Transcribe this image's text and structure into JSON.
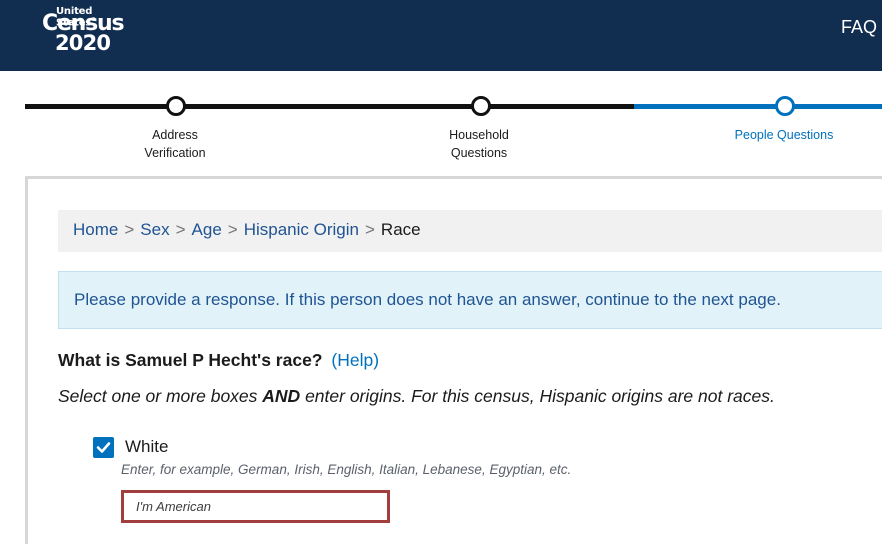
{
  "header": {
    "logo": {
      "line1": "United States",
      "line2": "Census",
      "line3": "2020"
    },
    "faq_label": "FAQ"
  },
  "progress": {
    "steps": [
      {
        "line1": "Address",
        "line2": "Verification",
        "state": "complete"
      },
      {
        "line1": "Household",
        "line2": "Questions",
        "state": "complete"
      },
      {
        "line1": "People Questions",
        "line2": "",
        "state": "current"
      }
    ]
  },
  "breadcrumb": {
    "items": [
      "Home",
      "Sex",
      "Age",
      "Hispanic Origin"
    ],
    "separator": ">",
    "current": "Race"
  },
  "alert": {
    "message": "Please provide a response. If this person does not have an answer, continue to the next page."
  },
  "question": {
    "text": "What is Samuel P Hecht's race?",
    "help_label": "(Help)",
    "instruction_before": "Select one or more boxes ",
    "instruction_bold": "AND",
    "instruction_after": " enter origins. For this census, Hispanic origins are not races."
  },
  "options": [
    {
      "label": "White",
      "checked": true,
      "hint": "Enter, for example, German, Irish, English, Italian, Lebanese, Egyptian, etc.",
      "input_value": "I'm American"
    }
  ],
  "colors": {
    "header_bg": "#112e51",
    "accent": "#0071bc",
    "error_border": "#a23e3e",
    "alert_bg": "#e1f3f8"
  }
}
